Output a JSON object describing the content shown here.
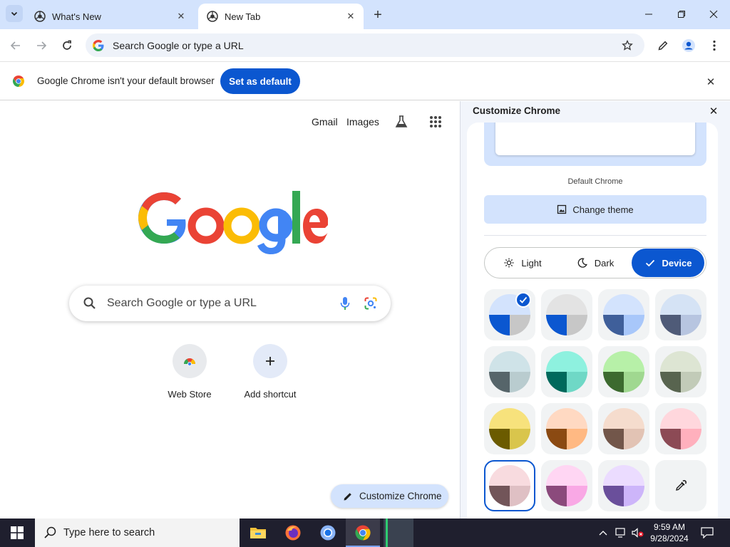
{
  "browser": {
    "tabs": [
      {
        "title": "What's New",
        "active": false
      },
      {
        "title": "New Tab",
        "active": true
      }
    ],
    "omnibox_text": "Search Google or type a URL"
  },
  "infobar": {
    "message": "Google Chrome isn't your default browser",
    "button_label": "Set as default"
  },
  "ntp": {
    "links": [
      "Gmail",
      "Images"
    ],
    "search_placeholder": "Search Google or type a URL",
    "shortcuts": [
      {
        "label": "Web Store"
      },
      {
        "label": "Add shortcut"
      }
    ],
    "customize_label": "Customize Chrome"
  },
  "side_panel": {
    "title": "Customize Chrome",
    "theme_caption": "Default Chrome",
    "change_theme_label": "Change theme",
    "modes": [
      {
        "label": "Light",
        "selected": false
      },
      {
        "label": "Dark",
        "selected": false
      },
      {
        "label": "Device",
        "selected": true
      }
    ],
    "swatches": [
      {
        "top": "#d3e3fd",
        "left": "#0b57d0",
        "right": "#c7c7c7",
        "selected_check": true
      },
      {
        "top": "#e3e3e3",
        "left": "#0b57d0",
        "right": "#c7c7c7"
      },
      {
        "top": "#d3e3fd",
        "left": "#3f5f9a",
        "right": "#a8c7fa"
      },
      {
        "top": "#d5e3f5",
        "left": "#4f5b78",
        "right": "#b7c5e0"
      },
      {
        "top": "#cfe3e8",
        "left": "#56656a",
        "right": "#b9cccf"
      },
      {
        "top": "#8ef1df",
        "left": "#00695c",
        "right": "#6fd8c6"
      },
      {
        "top": "#b7f0a8",
        "left": "#3c6a2f",
        "right": "#a0d890"
      },
      {
        "top": "#dde5d3",
        "left": "#58644f",
        "right": "#c2cbb8"
      },
      {
        "top": "#f7e27c",
        "left": "#6b5b00",
        "right": "#d9c54c"
      },
      {
        "top": "#ffd9c2",
        "left": "#8b4a12",
        "right": "#ffb983"
      },
      {
        "top": "#f5dccd",
        "left": "#72564a",
        "right": "#e2c3b4"
      },
      {
        "top": "#ffd7dd",
        "left": "#8c4a55",
        "right": "#ffb0bd"
      },
      {
        "top": "#f8dbdf",
        "left": "#725559",
        "right": "#dfc0c4",
        "selected_border": true
      },
      {
        "top": "#ffd6f3",
        "left": "#8b4a7c",
        "right": "#f9a8e5"
      },
      {
        "top": "#ebdcff",
        "left": "#6a4f9b",
        "right": "#cdb5fa"
      },
      {
        "eyedropper": true
      }
    ]
  },
  "taskbar": {
    "search_placeholder": "Type here to search",
    "time": "9:59 AM",
    "date": "9/28/2024"
  }
}
